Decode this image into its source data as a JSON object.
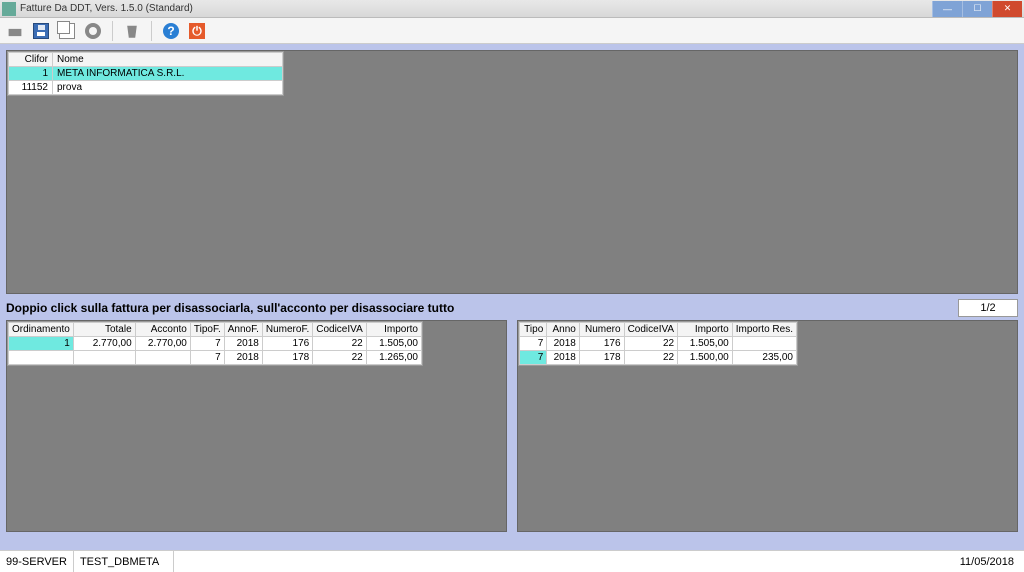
{
  "window": {
    "title": "Fatture Da DDT, Vers. 1.5.0 (Standard)"
  },
  "toolbar": {
    "help_glyph": "?",
    "power_glyph": "⏻"
  },
  "clients": {
    "headers": {
      "clifor": "Clifor",
      "nome": "Nome"
    },
    "rows": [
      {
        "clifor": "1",
        "nome": "META INFORMATICA S.R.L.",
        "selected": true
      },
      {
        "clifor": "11152",
        "nome": "prova",
        "selected": false
      }
    ]
  },
  "hint": "Doppio click sulla fattura per disassociarla, sull'acconto per disassociare tutto",
  "pager": "1/2",
  "left_grid": {
    "headers": [
      "Ordinamento",
      "Totale",
      "Acconto",
      "TipoF.",
      "AnnoF.",
      "NumeroF.",
      "CodiceIVA",
      "Importo"
    ],
    "rows": [
      {
        "cells": [
          "1",
          "2.770,00",
          "2.770,00",
          "7",
          "2018",
          "176",
          "22",
          "1.505,00"
        ],
        "selected": true
      },
      {
        "cells": [
          "",
          "",
          "",
          "7",
          "2018",
          "178",
          "22",
          "1.265,00"
        ],
        "selected": false
      }
    ]
  },
  "right_grid": {
    "headers": [
      "Tipo",
      "Anno",
      "Numero",
      "CodiceIVA",
      "Importo",
      "Importo Res."
    ],
    "rows": [
      {
        "cells": [
          "7",
          "2018",
          "176",
          "22",
          "1.505,00",
          ""
        ],
        "selected": false
      },
      {
        "cells": [
          "7",
          "2018",
          "178",
          "22",
          "1.500,00",
          "235,00"
        ],
        "selected": true
      }
    ]
  },
  "status": {
    "server": "99-SERVER",
    "db": "TEST_DBMETA",
    "date": "11/05/2018"
  }
}
